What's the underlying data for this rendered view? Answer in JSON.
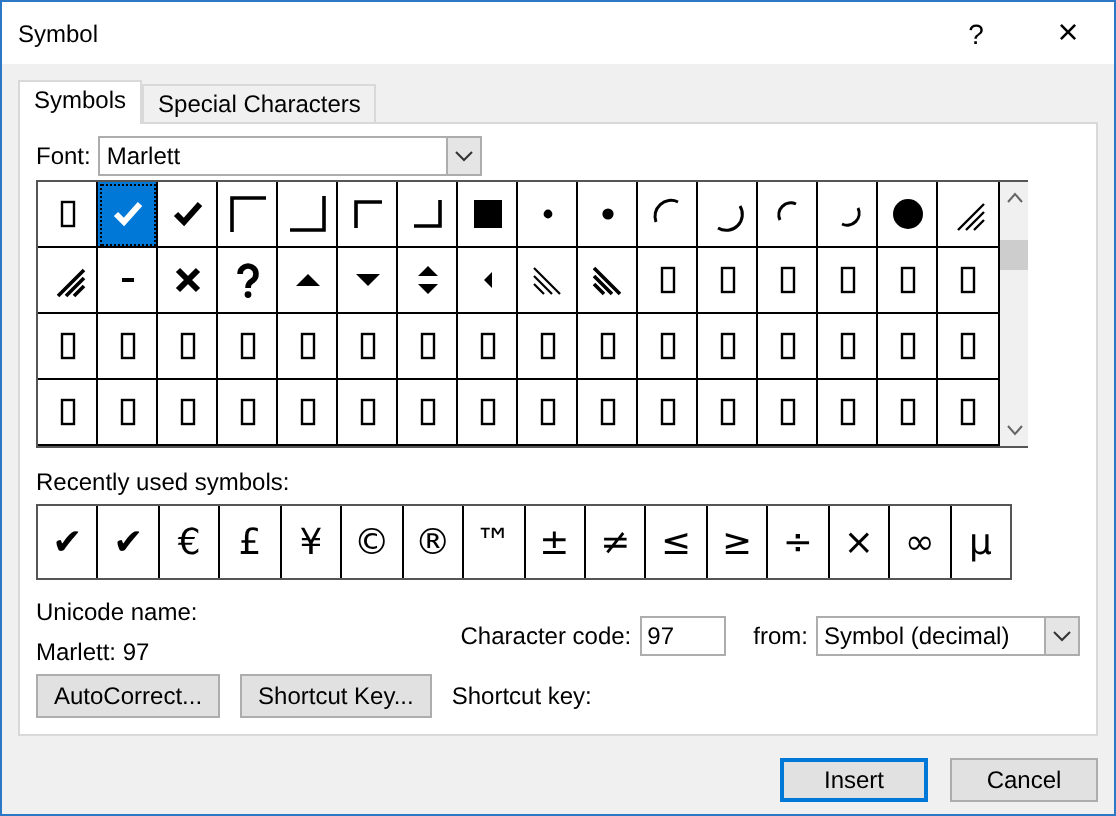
{
  "window": {
    "title": "Symbol",
    "help": "?",
    "close": "×"
  },
  "tabs": [
    {
      "label": "Symbols",
      "selected": true
    },
    {
      "label": "Special Characters",
      "selected": false
    }
  ],
  "font": {
    "label": "Font:",
    "value": "Marlett"
  },
  "symbol_grid": {
    "rows": [
      [
        {
          "kind": "box",
          "selected": false
        },
        {
          "kind": "check",
          "selected": true
        },
        {
          "kind": "check",
          "selected": false
        },
        {
          "kind": "corner-tl",
          "selected": false
        },
        {
          "kind": "corner-br",
          "selected": false
        },
        {
          "kind": "corner-tl-small",
          "selected": false
        },
        {
          "kind": "corner-br-small",
          "selected": false
        },
        {
          "kind": "square",
          "selected": false
        },
        {
          "kind": "dot-small",
          "selected": false
        },
        {
          "kind": "dot",
          "selected": false
        },
        {
          "kind": "arc-left",
          "selected": false
        },
        {
          "kind": "arc-right",
          "selected": false
        },
        {
          "kind": "arc-left-small",
          "selected": false
        },
        {
          "kind": "arc-right-small",
          "selected": false
        },
        {
          "kind": "disc",
          "selected": false
        },
        {
          "kind": "grip",
          "selected": false
        }
      ],
      [
        {
          "kind": "grip-bold",
          "selected": false
        },
        {
          "kind": "minus",
          "selected": false
        },
        {
          "kind": "x",
          "selected": false
        },
        {
          "kind": "question",
          "selected": false
        },
        {
          "kind": "tri-up",
          "selected": false
        },
        {
          "kind": "tri-down",
          "selected": false
        },
        {
          "kind": "tri-updown",
          "selected": false
        },
        {
          "kind": "tri-left",
          "selected": false
        },
        {
          "kind": "hatch",
          "selected": false
        },
        {
          "kind": "hatch-bold",
          "selected": false
        },
        {
          "kind": "box",
          "selected": false
        },
        {
          "kind": "box",
          "selected": false
        },
        {
          "kind": "box",
          "selected": false
        },
        {
          "kind": "box",
          "selected": false
        },
        {
          "kind": "box",
          "selected": false
        },
        {
          "kind": "box",
          "selected": false
        }
      ],
      [
        {
          "kind": "box",
          "selected": false
        },
        {
          "kind": "box",
          "selected": false
        },
        {
          "kind": "box",
          "selected": false
        },
        {
          "kind": "box",
          "selected": false
        },
        {
          "kind": "box",
          "selected": false
        },
        {
          "kind": "box",
          "selected": false
        },
        {
          "kind": "box",
          "selected": false
        },
        {
          "kind": "box",
          "selected": false
        },
        {
          "kind": "box",
          "selected": false
        },
        {
          "kind": "box",
          "selected": false
        },
        {
          "kind": "box",
          "selected": false
        },
        {
          "kind": "box",
          "selected": false
        },
        {
          "kind": "box",
          "selected": false
        },
        {
          "kind": "box",
          "selected": false
        },
        {
          "kind": "box",
          "selected": false
        },
        {
          "kind": "box",
          "selected": false
        }
      ],
      [
        {
          "kind": "box",
          "selected": false
        },
        {
          "kind": "box",
          "selected": false
        },
        {
          "kind": "box",
          "selected": false
        },
        {
          "kind": "box",
          "selected": false
        },
        {
          "kind": "box",
          "selected": false
        },
        {
          "kind": "box",
          "selected": false
        },
        {
          "kind": "box",
          "selected": false
        },
        {
          "kind": "box",
          "selected": false
        },
        {
          "kind": "box",
          "selected": false
        },
        {
          "kind": "box",
          "selected": false
        },
        {
          "kind": "box",
          "selected": false
        },
        {
          "kind": "box",
          "selected": false
        },
        {
          "kind": "box",
          "selected": false
        },
        {
          "kind": "box",
          "selected": false
        },
        {
          "kind": "box",
          "selected": false
        },
        {
          "kind": "box",
          "selected": false
        }
      ]
    ]
  },
  "recently_used": {
    "label": "Recently used symbols:",
    "symbols": [
      "✔",
      "✔",
      "€",
      "£",
      "¥",
      "©",
      "®",
      "™",
      "±",
      "≠",
      "≤",
      "≥",
      "÷",
      "×",
      "∞",
      "µ"
    ]
  },
  "unicode_name": {
    "label": "Unicode name:",
    "value": "Marlett: 97"
  },
  "character_code": {
    "label": "Character code:",
    "value": "97"
  },
  "from": {
    "label": "from:",
    "value": "Symbol (decimal)"
  },
  "buttons": [
    "AutoCorrect...",
    "Shortcut Key..."
  ],
  "shortcut_key": {
    "label": "Shortcut key:"
  },
  "footer_buttons": [
    {
      "label": "Insert",
      "default": true
    },
    {
      "label": "Cancel",
      "default": false
    }
  ]
}
